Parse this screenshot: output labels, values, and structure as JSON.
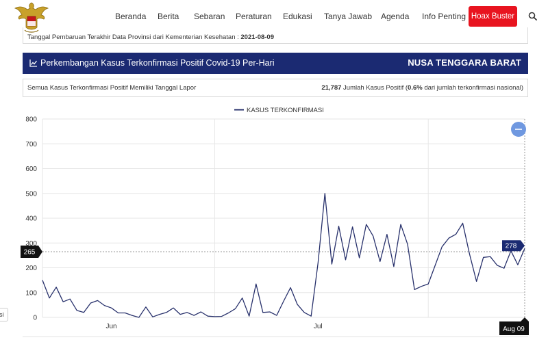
{
  "nav": {
    "items": [
      "Beranda",
      "Berita",
      "Sebaran",
      "Peraturan",
      "Edukasi",
      "Tanya Jawab",
      "Agenda",
      "Info Penting"
    ],
    "hoax_label": "Hoax Buster",
    "search_icon": "search-icon"
  },
  "update": {
    "label": "Tanggal Pembaruan Terakhir Data Provinsi dari Kementerian Kesehatan :",
    "date": "2021-08-09"
  },
  "title": {
    "text": "Perkembangan Kasus Terkonfirmasi Positif Covid-19 Per-Hari",
    "region": "NUSA TENGGARA BARAT",
    "icon": "line-chart-icon"
  },
  "summary": {
    "left": "Semua Kasus Terkonfirmasi Positif Memiliki Tanggal Lapor",
    "total": "21,787",
    "total_label": "Jumlah Kasus Positif (",
    "pct": "0.6%",
    "pct_suffix": "dari jumlah terkonfirmasi nasional)"
  },
  "side_tab": "si",
  "colors": {
    "nav_bg": "#1b2a72",
    "hoax": "#e8141f",
    "line": "#27306b",
    "zoom": "#6f98e0"
  },
  "chart_data": {
    "type": "line",
    "legend": "KASUS TERKONFIRMASI",
    "x_labels": [
      "Jun",
      "Jul",
      "Aug 09"
    ],
    "ylim": [
      0,
      800
    ],
    "yticks": [
      0,
      100,
      200,
      300,
      400,
      500,
      600,
      700,
      800
    ],
    "crosshair_y_label": "265",
    "tooltip_value": "278",
    "values": [
      150,
      78,
      122,
      63,
      74,
      28,
      20,
      58,
      68,
      48,
      38,
      18,
      18,
      8,
      0,
      42,
      2,
      12,
      20,
      38,
      12,
      20,
      8,
      22,
      5,
      3,
      4,
      18,
      35,
      78,
      5,
      135,
      20,
      22,
      8,
      65,
      120,
      52,
      20,
      5,
      220,
      500,
      215,
      368,
      232,
      365,
      240,
      375,
      328,
      225,
      335,
      205,
      375,
      295,
      112,
      125,
      135,
      210,
      285,
      320,
      335,
      380,
      255,
      145,
      242,
      245,
      210,
      198,
      268,
      212,
      278
    ]
  }
}
